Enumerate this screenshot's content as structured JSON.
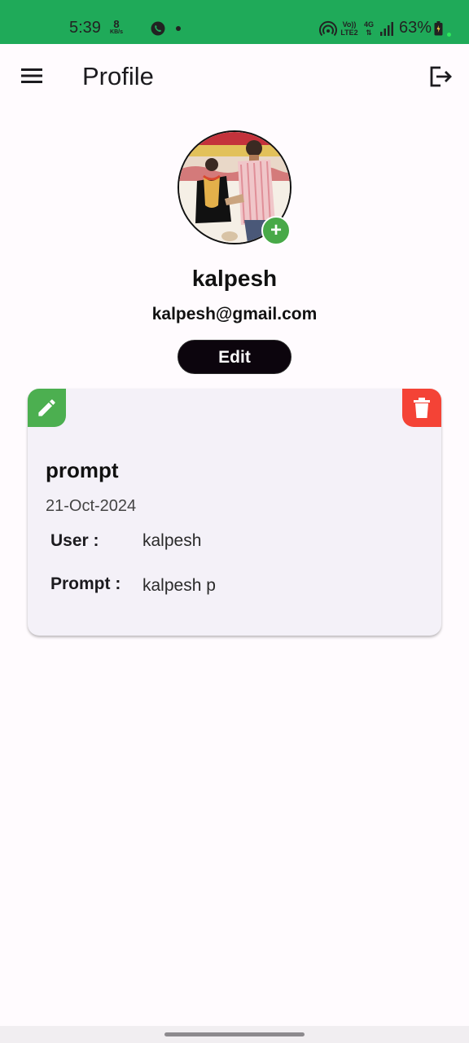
{
  "status_bar": {
    "time": "5:39",
    "net_speed_value": "8",
    "net_speed_unit": "KB/s",
    "volte_line1": "Vo))",
    "volte_line2": "LTE2",
    "network_type": "4G",
    "battery_percent": "63%",
    "icons": [
      "whatsapp-icon",
      "hotspot-icon",
      "signal-icon",
      "battery-icon"
    ],
    "background_color": "#1faa59"
  },
  "app_bar": {
    "title": "Profile",
    "menu_icon": "menu-icon",
    "logout_icon": "logout-icon"
  },
  "profile": {
    "name": "kalpesh",
    "email": "kalpesh@gmail.com",
    "add_photo_label": "+",
    "edit_label": "Edit",
    "add_photo_color": "#48a948"
  },
  "card": {
    "title": "prompt",
    "date": "21-Oct-2024",
    "user_label": "User :",
    "user_value": "kalpesh",
    "prompt_label": "Prompt :",
    "prompt_value": "kalpesh p",
    "edit_icon": "pencil-icon",
    "delete_icon": "trash-icon",
    "edit_color": "#4caf50",
    "delete_color": "#f44336"
  }
}
